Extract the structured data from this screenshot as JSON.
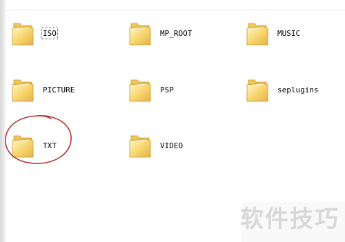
{
  "folders": [
    {
      "name": "ISO",
      "selected": true
    },
    {
      "name": "MP_ROOT",
      "selected": false
    },
    {
      "name": "MUSIC",
      "selected": false
    },
    {
      "name": "PICTURE",
      "selected": false
    },
    {
      "name": "PSP",
      "selected": false
    },
    {
      "name": "seplugins",
      "selected": false
    },
    {
      "name": "TXT",
      "selected": false
    },
    {
      "name": "VIDEO",
      "selected": false
    }
  ],
  "watermark": "软件技巧",
  "colors": {
    "folder_fill": "#f6d46a",
    "folder_dark": "#d9a93a",
    "highlight_circle": "#b3333a"
  }
}
